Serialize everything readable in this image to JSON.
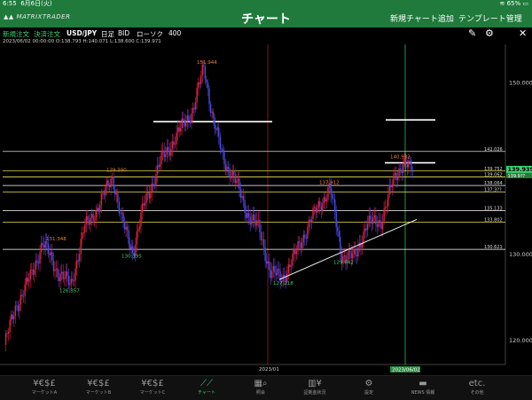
{
  "status": {
    "time": "6:55",
    "date": "6月6日(火)",
    "battery": "65%"
  },
  "header": {
    "logo": "MATRIXTRADER",
    "title": "チャート",
    "add_chart": "新規チャート追加",
    "template": "テンプレート管理"
  },
  "toolbar": {
    "new_order": "新規注文",
    "settle_order": "決済注文",
    "pair": "USD/JPY",
    "period": "日足",
    "side": "BID",
    "type": "ローソク",
    "count": "400"
  },
  "ohlc": "2023/06/02 00:00:00  O:138.793  H:140.071  L:138.600  C:139.971",
  "colors": {
    "up": "#e0233a",
    "down": "#4a4ae8",
    "accent": "#3cd070"
  },
  "chart_data": {
    "type": "candlestick",
    "price_ticks": [
      150.0,
      140.0,
      130.0,
      120.0
    ],
    "ylim": [
      117.2,
      154.3
    ],
    "x_label_mid": "2023/01",
    "x_label_current": "2023/06/02",
    "current_price": "139.939",
    "current_price_tag2": "139.9??",
    "level_lines": [
      {
        "value": 142.026,
        "label": "142.026",
        "color": "#d8d8d8"
      },
      {
        "value": 139.752,
        "label": "139.752",
        "color": "#e8e050"
      },
      {
        "value": 139.062,
        "label": "139.062",
        "color": "#e8e050"
      },
      {
        "value": 138.064,
        "label": "138.064",
        "color": "#ffffff"
      },
      {
        "value": 137.3,
        "label": "137.3??",
        "color": "#e8e050"
      },
      {
        "value": 135.133,
        "label": "135.133",
        "color": "#ffffff"
      },
      {
        "value": 133.802,
        "label": "133.802",
        "color": "#e8e050"
      },
      {
        "value": 130.621,
        "label": "130.621",
        "color": "#ffffff"
      }
    ],
    "annotations": [
      {
        "text": "151.944",
        "value": 151.944,
        "color": "#e8823c"
      },
      {
        "text": "131.348",
        "value": 131.348,
        "color": "#e8823c"
      },
      {
        "text": "126.357",
        "value": 126.357,
        "color": "#3cd070"
      },
      {
        "text": "139.390",
        "value": 139.39,
        "color": "#e8823c"
      },
      {
        "text": "130.395",
        "value": 130.395,
        "color": "#3cd070"
      },
      {
        "text": "127.218",
        "value": 127.218,
        "color": "#3cd070"
      },
      {
        "text": "137.912",
        "value": 137.912,
        "color": "#e8823c"
      },
      {
        "text": "129.642",
        "value": 129.642,
        "color": "#3cd070"
      },
      {
        "text": "140.932",
        "value": 140.932,
        "color": "#e8823c"
      }
    ],
    "trendline": [
      [
        129.3,
        127.3
      ],
      [
        163.7,
        134.3
      ]
    ]
  },
  "tabs": [
    {
      "icon": "¥€$£",
      "label": "マーケットA"
    },
    {
      "icon": "¥€$£",
      "label": "マーケットB"
    },
    {
      "icon": "¥€$£",
      "label": "マーケットC"
    },
    {
      "icon": "⟋⟋",
      "label": "チャート"
    },
    {
      "icon": "▦⌕",
      "label": "照会"
    },
    {
      "icon": "▥¥",
      "label": "証拠金状況"
    },
    {
      "icon": "⚙",
      "label": "設定"
    },
    {
      "icon": "▬",
      "label": "NEWS 情報"
    },
    {
      "icon": "etc.",
      "label": "その他"
    }
  ]
}
